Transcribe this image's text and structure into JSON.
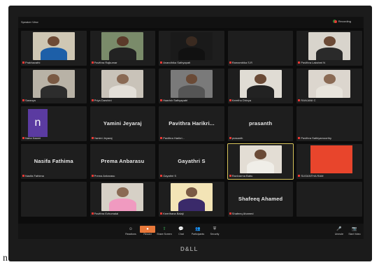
{
  "window": {
    "speaker_view_label": "Speaker View",
    "recording_label": "Recording"
  },
  "participants": [
    {
      "name": "Prabhavathi",
      "video": true,
      "skin": "#6e4a35",
      "shirt": "#1d5fa8",
      "bg": "#cfc7b4"
    },
    {
      "name": "Pavithra Rajkumar",
      "video": true,
      "skin": "#5b3a2a",
      "shirt": "#222",
      "bg": "#7a8b6a"
    },
    {
      "name": "Anandhika Sathyapati",
      "video": true,
      "skin": "#3a2a20",
      "shirt": "#111",
      "bg": "#1a1a1a"
    },
    {
      "name": "Ramambika S.R",
      "video": false
    },
    {
      "name": "Pavithra Lakshmi N",
      "video": true,
      "skin": "#6b4a36",
      "shirt": "#2a2a2a",
      "bg": "#d8d4cc"
    },
    {
      "name": "Saranya",
      "video": true,
      "skin": "#7a5a44",
      "shirt": "#2d2d2d",
      "bg": "#b8b2a6"
    },
    {
      "name": "Priya Darshini",
      "video": true,
      "skin": "#8a6a54",
      "shirt": "#e3dfd8",
      "bg": "#c9c3b9"
    },
    {
      "name": "Haarish Sathyapatri",
      "video": true,
      "skin": "#6a4a36",
      "shirt": "#555",
      "bg": "#7a7a7a"
    },
    {
      "name": "Keerthu Dhivya",
      "video": true,
      "skin": "#6a4a36",
      "shirt": "#222",
      "bg": "#e0dcd4"
    },
    {
      "name": "RANJANI C",
      "video": true,
      "skin": "#8a6a54",
      "shirt": "#e8e4dc",
      "bg": "#dcd6ce"
    },
    {
      "name": "Naha Naomi",
      "video": false,
      "avatar": "n"
    },
    {
      "name": "Yamini Jeyaraj",
      "video": false,
      "big": true
    },
    {
      "name": "Pavithra Harikri...",
      "video": false,
      "big": true
    },
    {
      "name": "prasanth",
      "video": false,
      "big": true
    },
    {
      "name": "Pavithra Sathiyamoorthy",
      "video": false
    },
    {
      "name": "Nasifa Fathima",
      "video": false,
      "big": true
    },
    {
      "name": "Prema Anbarasu",
      "video": false,
      "big": true
    },
    {
      "name": "Gayathri S",
      "video": false,
      "big": true
    },
    {
      "name": "Ravivarma Babu",
      "video": true,
      "active": true,
      "skin": "#6a4a36",
      "shirt": "#f0eee8",
      "bg": "#e3ddd4"
    },
    {
      "name": "SUGANTHA RAM",
      "video": false,
      "red": true
    },
    {
      "name": "",
      "video": false
    },
    {
      "name": "Pavithra Ezhumalai",
      "video": true,
      "skin": "#8a6a54",
      "shirt": "#f09ac0",
      "bg": "#d6d0c6"
    },
    {
      "name": "Keerthana Balaji",
      "video": true,
      "skin": "#7a5a44",
      "shirt": "#3a2a6a",
      "bg": "#f3e4b6"
    },
    {
      "name": "Shafeeq Ahamed",
      "video": false,
      "big": true
    },
    {
      "name": "",
      "video": false
    }
  ],
  "toolbar": {
    "left": [
      {
        "label": "Unmute",
        "glyph": "🎤"
      },
      {
        "label": "Start Video",
        "glyph": "📷"
      }
    ],
    "center": [
      {
        "label": "Security",
        "glyph": "⛨"
      },
      {
        "label": "Participants",
        "glyph": "👥"
      },
      {
        "label": "Chat",
        "glyph": "💬"
      },
      {
        "label": "Share Screen",
        "glyph": "⇧",
        "accent": "green"
      },
      {
        "label": "Record",
        "glyph": "●",
        "accent": "orange"
      },
      {
        "label": "Reactions",
        "glyph": "☺"
      }
    ]
  },
  "monitor_brand": "D&LL",
  "stray_text": "n"
}
